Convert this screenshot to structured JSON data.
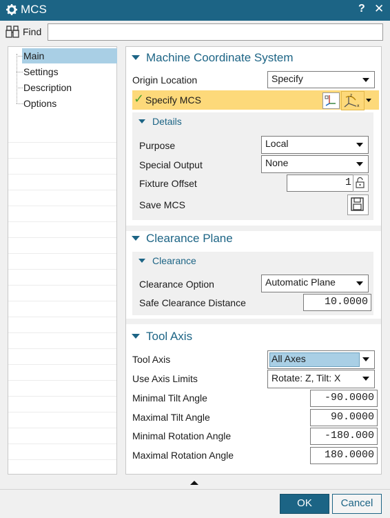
{
  "window": {
    "title": "MCS",
    "help_label": "?",
    "close_label": "✕"
  },
  "find": {
    "label": "Find",
    "value": ""
  },
  "tree": {
    "items": [
      "Main",
      "Settings",
      "Description",
      "Options"
    ],
    "selected": "Main"
  },
  "mcs_section": {
    "title": "Machine Coordinate System",
    "origin_location_label": "Origin Location",
    "origin_location_value": "Specify",
    "check_mark": "✓",
    "specify_mcs_label": "Specify MCS",
    "details": {
      "title": "Details",
      "purpose_label": "Purpose",
      "purpose_value": "Local",
      "special_output_label": "Special Output",
      "special_output_value": "None",
      "fixture_offset_label": "Fixture Offset",
      "fixture_offset_value": "1",
      "save_mcs_label": "Save MCS"
    }
  },
  "clearance_section": {
    "title": "Clearance Plane",
    "sub_title": "Clearance",
    "option_label": "Clearance Option",
    "option_value": "Automatic Plane",
    "safe_distance_label": "Safe Clearance Distance",
    "safe_distance_value": "10.0000"
  },
  "tool_axis_section": {
    "title": "Tool Axis",
    "tool_axis_label": "Tool Axis",
    "tool_axis_value": "All Axes",
    "use_axis_limits_label": "Use Axis Limits",
    "use_axis_limits_value": "Rotate: Z, Tilt: X",
    "min_tilt_label": "Minimal Tilt Angle",
    "min_tilt_value": "-90.0000",
    "max_tilt_label": "Maximal Tilt Angle",
    "max_tilt_value": "90.0000",
    "min_rot_label": "Minimal Rotation Angle",
    "min_rot_value": "-180.000",
    "max_rot_label": "Maximal Rotation Angle",
    "max_rot_value": "180.0000"
  },
  "buttons": {
    "ok": "OK",
    "cancel": "Cancel"
  },
  "colors": {
    "accent": "#1c6485",
    "selection": "#a9cfe5",
    "highlight_row": "#fdd97a"
  }
}
